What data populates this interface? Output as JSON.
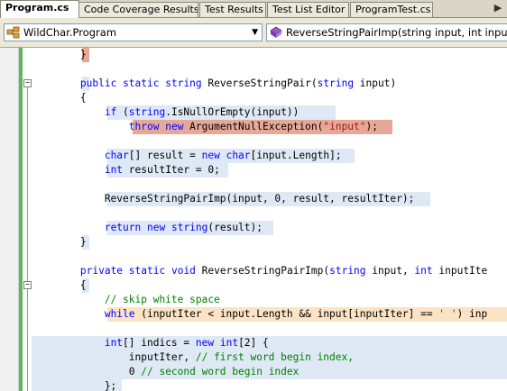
{
  "tabs": [
    {
      "label": "Program.cs",
      "active": true
    },
    {
      "label": "Code Coverage Results",
      "active": false
    },
    {
      "label": "Test Results",
      "active": false
    },
    {
      "label": "Test List Editor",
      "active": false
    },
    {
      "label": "ProgramTest.cs",
      "active": false
    }
  ],
  "tab_controls": {
    "scroll_icon": "tab-scroll-icon"
  },
  "navigation": {
    "type_combo": {
      "value": "WildChar.Program",
      "icon": "class-icon"
    },
    "member_combo": {
      "value": "ReverseStringPairImp(string input, int inputIte",
      "icon": "method-icon"
    }
  },
  "coverage_colors": {
    "covered": "#dfe9f5",
    "not_covered": "#e8a898",
    "partially_covered": "#fbe3c4"
  },
  "code": {
    "l0": {
      "tok0": "        }"
    },
    "l2": {
      "tok0": "        ",
      "tok1": "public",
      "tok2": " ",
      "tok3": "static",
      "tok4": " ",
      "tok5": "string",
      "tok6": " ReverseStringPair(",
      "tok7": "string",
      "tok8": " input)"
    },
    "l3": {
      "tok0": "        {"
    },
    "l4": {
      "tok0": "            ",
      "tok1": "if",
      "tok2": " (",
      "tok3": "string",
      "tok4": ".IsNullOrEmpty(input))"
    },
    "l5": {
      "tok0": "                ",
      "tok1": "throw",
      "tok2": " ",
      "tok3": "new",
      "tok4": " ArgumentNullException(",
      "tok5": "\"input\"",
      "tok6": ");"
    },
    "l7": {
      "tok0": "            ",
      "tok1": "char",
      "tok2": "[] result = ",
      "tok3": "new",
      "tok4": " ",
      "tok5": "char",
      "tok6": "[input.Length];"
    },
    "l8": {
      "tok0": "            ",
      "tok1": "int",
      "tok2": " resultIter = 0;"
    },
    "l10": {
      "tok0": "            ReverseStringPairImp(input, 0, result, resultIter);"
    },
    "l12": {
      "tok0": "            ",
      "tok1": "return",
      "tok2": " ",
      "tok3": "new",
      "tok4": " ",
      "tok5": "string",
      "tok6": "(result);"
    },
    "l13": {
      "tok0": "        }"
    },
    "l15": {
      "tok0": "        ",
      "tok1": "private",
      "tok2": " ",
      "tok3": "static",
      "tok4": " ",
      "tok5": "void",
      "tok6": " ReverseStringPairImp(",
      "tok7": "string",
      "tok8": " input, ",
      "tok9": "int",
      "tok10": " inputIte"
    },
    "l16": {
      "tok0": "        {"
    },
    "l17": {
      "tok0": "            ",
      "tok1": "// skip white space"
    },
    "l18": {
      "tok0": "            ",
      "tok1": "while",
      "tok2": " (inputIter < input.Length && input[inputIter] == ",
      "tok3": "' '",
      "tok4": ") inp"
    },
    "l20": {
      "tok0": "            ",
      "tok1": "int",
      "tok2": "[] indics = ",
      "tok3": "new",
      "tok4": " ",
      "tok5": "int",
      "tok6": "[2] {"
    },
    "l21": {
      "tok0": "                inputIter, ",
      "tok1": "// first word begin index,"
    },
    "l22": {
      "tok0": "                0 ",
      "tok1": "// second word begin index"
    },
    "l23": {
      "tok0": "            };"
    }
  }
}
